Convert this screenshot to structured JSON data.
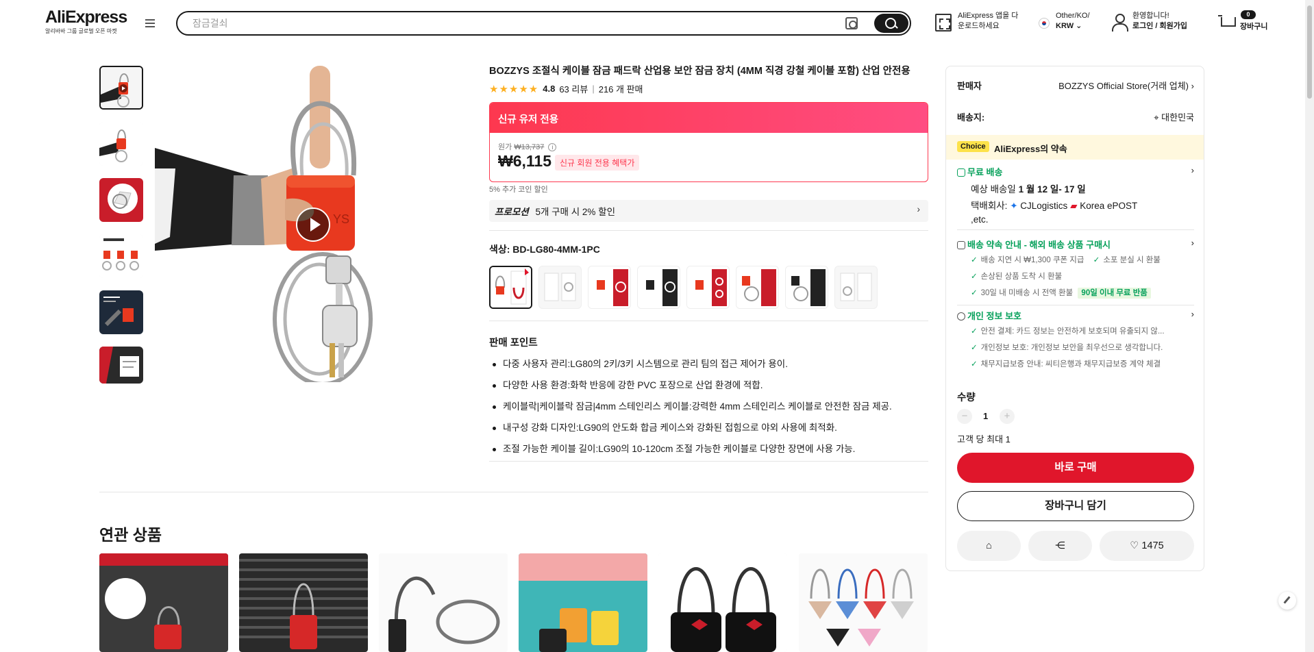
{
  "header": {
    "logo": "AliExpress",
    "logo_sub": "알리바바 그룹 글로벌 오픈 마켓",
    "search_placeholder": "잠금걸쇠",
    "app_line1": "AliExpress 앱을 다",
    "app_line2": "운로드하세요",
    "region_line1": "Other/KO/",
    "region_line2": "KRW",
    "greeting": "환영합니다!",
    "login": "로그인 / 회원가입",
    "cart_count": "0",
    "cart_label": "장바구니"
  },
  "product": {
    "title": "BOZZYS 조절식 케이블 잠금 패드락 산업용 보안 잠금 장치 (4MM 직경 강철 케이블 포함) 산업 안전용",
    "rating": "4.8",
    "reviews": "63 리뷰",
    "sold": "216 개 판매",
    "promo_header": "신규 유저 전용",
    "orig_label": "원가",
    "orig_price": "₩13,737",
    "price": "₩6,115",
    "new_member_tag": "신규 회원 전용 혜택가",
    "coin_text": "5% 추가 코인 할인",
    "promotion_label": "프로모션",
    "promotion_text": "5개 구매 시 2% 할인",
    "color_label": "색상: BD-LG80-4MM-1PC",
    "selling_points_title": "판매 포인트",
    "selling_points": [
      "다중 사용자 관리:LG80의 2키/3키 시스템으로 관리 팀의 접근 제어가 용이.",
      "다양한 사용 환경:화학 반응에 강한 PVC 포장으로 산업 환경에 적합.",
      "케이블락|케이블락 잠금|4mm 스테인리스 케이블:강력한 4mm 스테인리스 케이블로 안전한 잠금 제공.",
      "내구성 강화 디자인:LG90의 안도화 합금 케이스와 강화된 접힘으로 야외 사용에 최적화.",
      "조절 가능한 케이블 길이:LG90의 10-120cm 조절 가능한 케이블로 다양한 장면에 사용 가능."
    ]
  },
  "panel": {
    "seller_label": "판매자",
    "seller_value": "BOZZYS Official Store(거래 업체)",
    "ship_to_label": "배송지:",
    "ship_to_value": "대한민국",
    "choice_tag": "Choice",
    "choice_text": "AliExpress의 약속",
    "free_shipping": "무료 배송",
    "delivery_label": "예상 배송일",
    "delivery_date": "1 월 12 일- 17 일",
    "carrier_label": "택배회사:",
    "carrier_1": "CJLogistics",
    "carrier_2": "Korea",
    "carrier_3": "ePOST ,etc.",
    "promise_title": "배송 약속 안내 - 해외 배송 상품 구매시",
    "promise_1": "배송 지연 시 ₩1,300 쿠폰 지급",
    "promise_2": "소포 분실 시 환불",
    "promise_3": "손상된 상품 도착 시 환불",
    "promise_4": "30일 내 미배송 시 전액 환불",
    "promise_badge": "90일 이내 무료 반품",
    "privacy_title": "개인 정보 보호",
    "privacy_1": "안전 결제: 카드 정보는 안전하게 보호되며 유출되지 않...",
    "privacy_2": "개인정보 보호: 개인정보 보안을 최우선으로 생각합니다.",
    "privacy_3": "채무지급보증 안내: 씨티은행과 채무지급보증 계약 체결",
    "qty_label": "수량",
    "qty_minus": "−",
    "qty_plus": "+",
    "qty_value": "1",
    "qty_limit": "고객 당 최대 1",
    "buy_now": "바로 구매",
    "add_to_cart": "장바구니 담기",
    "wishlist_count": "1475"
  },
  "related": {
    "title": "연관 상품"
  },
  "colors": {
    "accent_red": "#e0162b",
    "promo_pink": "#fd384f",
    "green": "#05a05a"
  }
}
